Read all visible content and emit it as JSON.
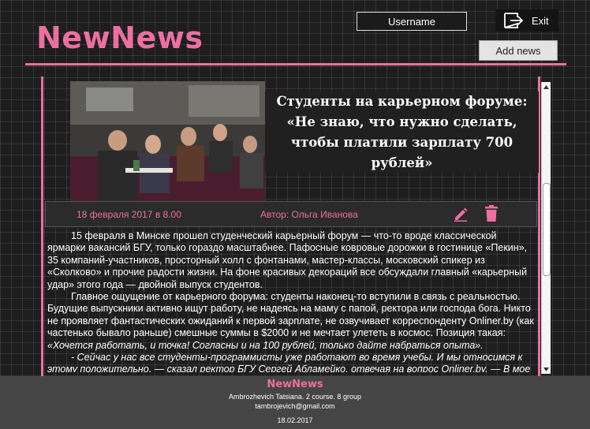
{
  "header": {
    "logo": "NewNews",
    "username_placeholder": "Username",
    "exit_label": "Exit",
    "add_news_label": "Add news"
  },
  "article": {
    "title": "Студенты на карьерном форуме: «Не знаю, что нужно сделать, чтобы платили зарплату 700 рублей»",
    "date": "18 февраля 2017 в 8.00",
    "author": "Автор: Ольга Иванова",
    "paragraphs": [
      "15 февраля в Минске прошел студенческий карьерный форум — что-то вроде классической ярмарки вакансий БГУ, только гораздо масштабнее. Пафосные ковровые дорожки в гостинице «Пекин», 35 компаний-участников, просторный холл с фонтанами, мастер-классы, московский спикер из «Сколково» и прочие радости жизни. На фоне красивых декораций все обсуждали главный «карьерный удар» этого года — двойной выпуск студентов.",
      "Главное ощущение от карьерного форума: студенты наконец-то вступили в связь с реальностью. Будущие выпускники активно ищут работу, не надеясь на маму с папой, ректора или господа бога. Никто не проявляет фантастических ожиданий к первой зарплате, не озвучивает корреспонденту Onliner.by (как частенько бывало раньше) смешные суммы в $2000 и не мечтает улететь в космос. Позиция такая:"
    ],
    "quote1": "«Хочется работать, и точка! Согласны и на 100 рублей, только дайте набраться опыта».",
    "quote2": "- Сейчас у нас все студенты-программисты уже работают во время учебы. И мы относимся к этому положительно, — сказал ректор БГУ Сергей Абламейко, отвечая на вопрос Onliner.by. — В мое"
  },
  "footer": {
    "logo": "NewNews",
    "author": "Ambrozhevich Tatsiana. 2 course. 8  group",
    "email": "tambrojevich@gmail.com",
    "date": "18.02.2017"
  },
  "colors": {
    "accent": "#ec6fa0",
    "background": "#1e1e1e",
    "footer": "#484848"
  },
  "icons": [
    "exit-icon",
    "edit-icon",
    "delete-icon",
    "scroll-up-icon",
    "scroll-down-icon"
  ]
}
